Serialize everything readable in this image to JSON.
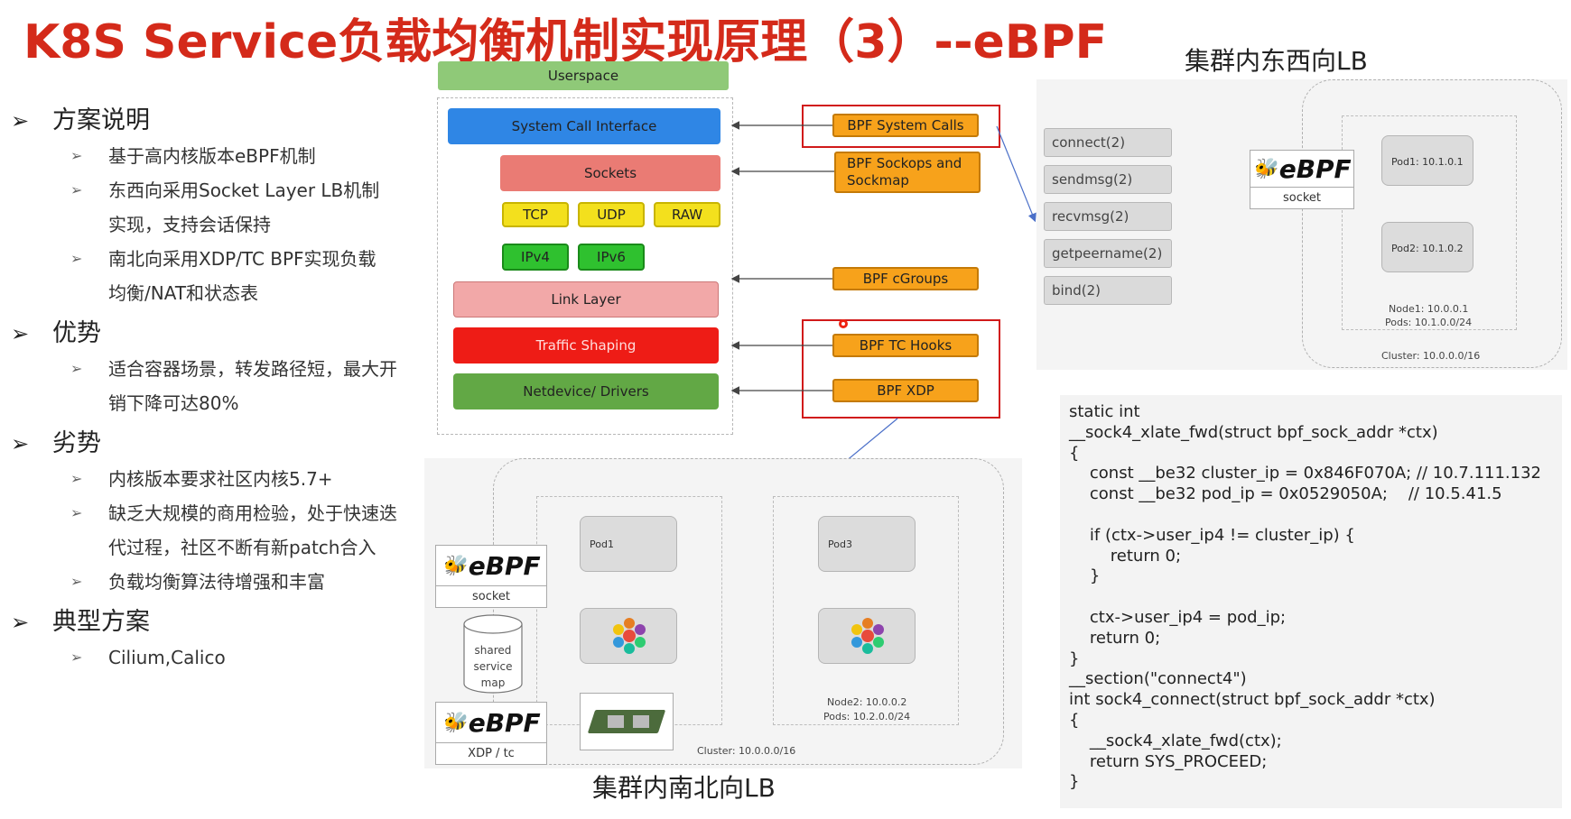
{
  "title": "K8S Service负载均衡机制实现原理（3）--eBPF",
  "left": {
    "sections": [
      {
        "heading": "方案说明",
        "items": [
          "基于高内核版本eBPF机制",
          "东西向采用Socket Layer LB机制",
          "实现，支持会话保持",
          "南北向采用XDP/TC BPF实现负载",
          "均衡/NAT和状态表"
        ]
      },
      {
        "heading": "优势",
        "items": [
          "适合容器场景，转发路径短，最大开",
          "销下降可达80%"
        ]
      },
      {
        "heading": "劣势",
        "items": [
          "内核版本要求社区内核5.7+",
          "缺乏大规模的商用检验，处于快速迭",
          "代过程，社区不断有新patch合入",
          "负载均衡算法待增强和丰富"
        ]
      },
      {
        "heading": "典型方案",
        "items": [
          "Cilium,Calico"
        ]
      }
    ]
  },
  "stack": {
    "userspace": "Userspace",
    "syscall_interface": "System Call Interface",
    "sockets": "Sockets",
    "tcp": "TCP",
    "udp": "UDP",
    "raw": "RAW",
    "ipv4": "IPv4",
    "ipv6": "IPv6",
    "link_layer": "Link Layer",
    "traffic_shaping": "Traffic Shaping",
    "netdevice": "Netdevice/ Drivers"
  },
  "hooks": {
    "syscalls": "BPF System Calls",
    "sockops": "BPF Sockops and Sockmap",
    "cgroups": "BPF cGroups",
    "tc": "BPF TC Hooks",
    "xdp": "BPF XDP"
  },
  "east_west": {
    "label": "集群内东西向LB",
    "syscalls": [
      "connect(2)",
      "sendmsg(2)",
      "recvmsg(2)",
      "getpeername(2)",
      "bind(2)"
    ],
    "ebpf_text": "eBPF",
    "ebpf_sub": "socket",
    "pod1": "Pod1: 10.1.0.1",
    "pod2": "Pod2: 10.1.0.2",
    "node1": "Node1: 10.0.0.1",
    "node1_pods": "Pods: 10.1.0.0/24",
    "cluster": "Cluster: 10.0.0.0/16"
  },
  "north_south": {
    "label": "集群内南北向LB",
    "ebpf_text": "eBPF",
    "ebpf_sub_socket": "socket",
    "ebpf_sub_xdp": "XDP / tc",
    "shared_map": [
      "shared",
      "service",
      "map"
    ],
    "pod1": "Pod1",
    "pod3": "Pod3",
    "node2": "Node2: 10.0.0.2",
    "node2_pods": "Pods: 10.2.0.0/24",
    "cluster": "Cluster: 10.0.0.0/16"
  },
  "code": "static int\n__sock4_xlate_fwd(struct bpf_sock_addr *ctx)\n{\n    const __be32 cluster_ip = 0x846F070A; // 10.7.111.132\n    const __be32 pod_ip = 0x0529050A;    // 10.5.41.5\n\n    if (ctx->user_ip4 != cluster_ip) {\n        return 0;\n    }\n\n    ctx->user_ip4 = pod_ip;\n    return 0;\n}\n__section(\"connect4\")\nint sock4_connect(struct bpf_sock_addr *ctx)\n{\n    __sock4_xlate_fwd(ctx);\n    return SYS_PROCEED;\n}",
  "colors": {
    "title": "#d42a1a",
    "userspace": "#8fc978",
    "syscall_interface": "#2f86e5",
    "sockets": "#ea7b74",
    "proto": "#f3e01d",
    "ip": "#2fc12f",
    "link": "#f2a8a8",
    "traffic": "#ee1c16",
    "netdevice": "#62a845",
    "hook": "#f7a21b",
    "frame": "#d11a1a"
  }
}
